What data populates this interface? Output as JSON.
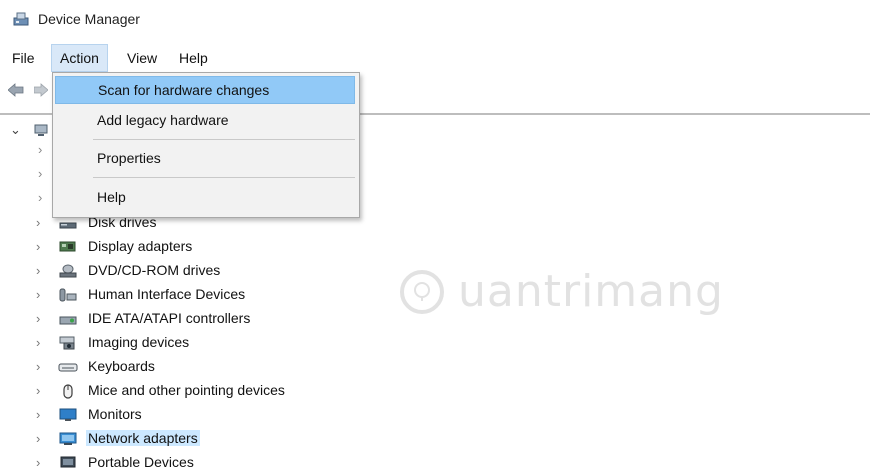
{
  "window": {
    "title": "Device Manager"
  },
  "menu": {
    "file": "File",
    "action": "Action",
    "view": "View",
    "help": "Help"
  },
  "action_menu": {
    "items": [
      {
        "label": "Scan for hardware changes",
        "highlighted": true
      },
      {
        "label": "Add legacy hardware"
      },
      {
        "label": "Properties"
      },
      {
        "label": "Help"
      }
    ]
  },
  "tree": {
    "items": [
      {
        "label": "Disk drives",
        "icon": "disk-drive-icon"
      },
      {
        "label": "Display adapters",
        "icon": "display-adapter-icon"
      },
      {
        "label": "DVD/CD-ROM drives",
        "icon": "dvd-drive-icon"
      },
      {
        "label": "Human Interface Devices",
        "icon": "hid-icon"
      },
      {
        "label": "IDE ATA/ATAPI controllers",
        "icon": "ide-controller-icon"
      },
      {
        "label": "Imaging devices",
        "icon": "camera-icon"
      },
      {
        "label": "Keyboards",
        "icon": "keyboard-icon"
      },
      {
        "label": "Mice and other pointing devices",
        "icon": "mouse-icon"
      },
      {
        "label": "Monitors",
        "icon": "monitor-icon"
      },
      {
        "label": "Network adapters",
        "icon": "network-adapter-icon",
        "selected": true
      },
      {
        "label": "Portable Devices",
        "icon": "portable-device-icon"
      }
    ]
  },
  "watermark": {
    "text": "uantrimang"
  },
  "colors": {
    "selection": "#cce8ff",
    "menu_highlight": "#91c9f7",
    "menu_bg": "#f2f2f2"
  }
}
